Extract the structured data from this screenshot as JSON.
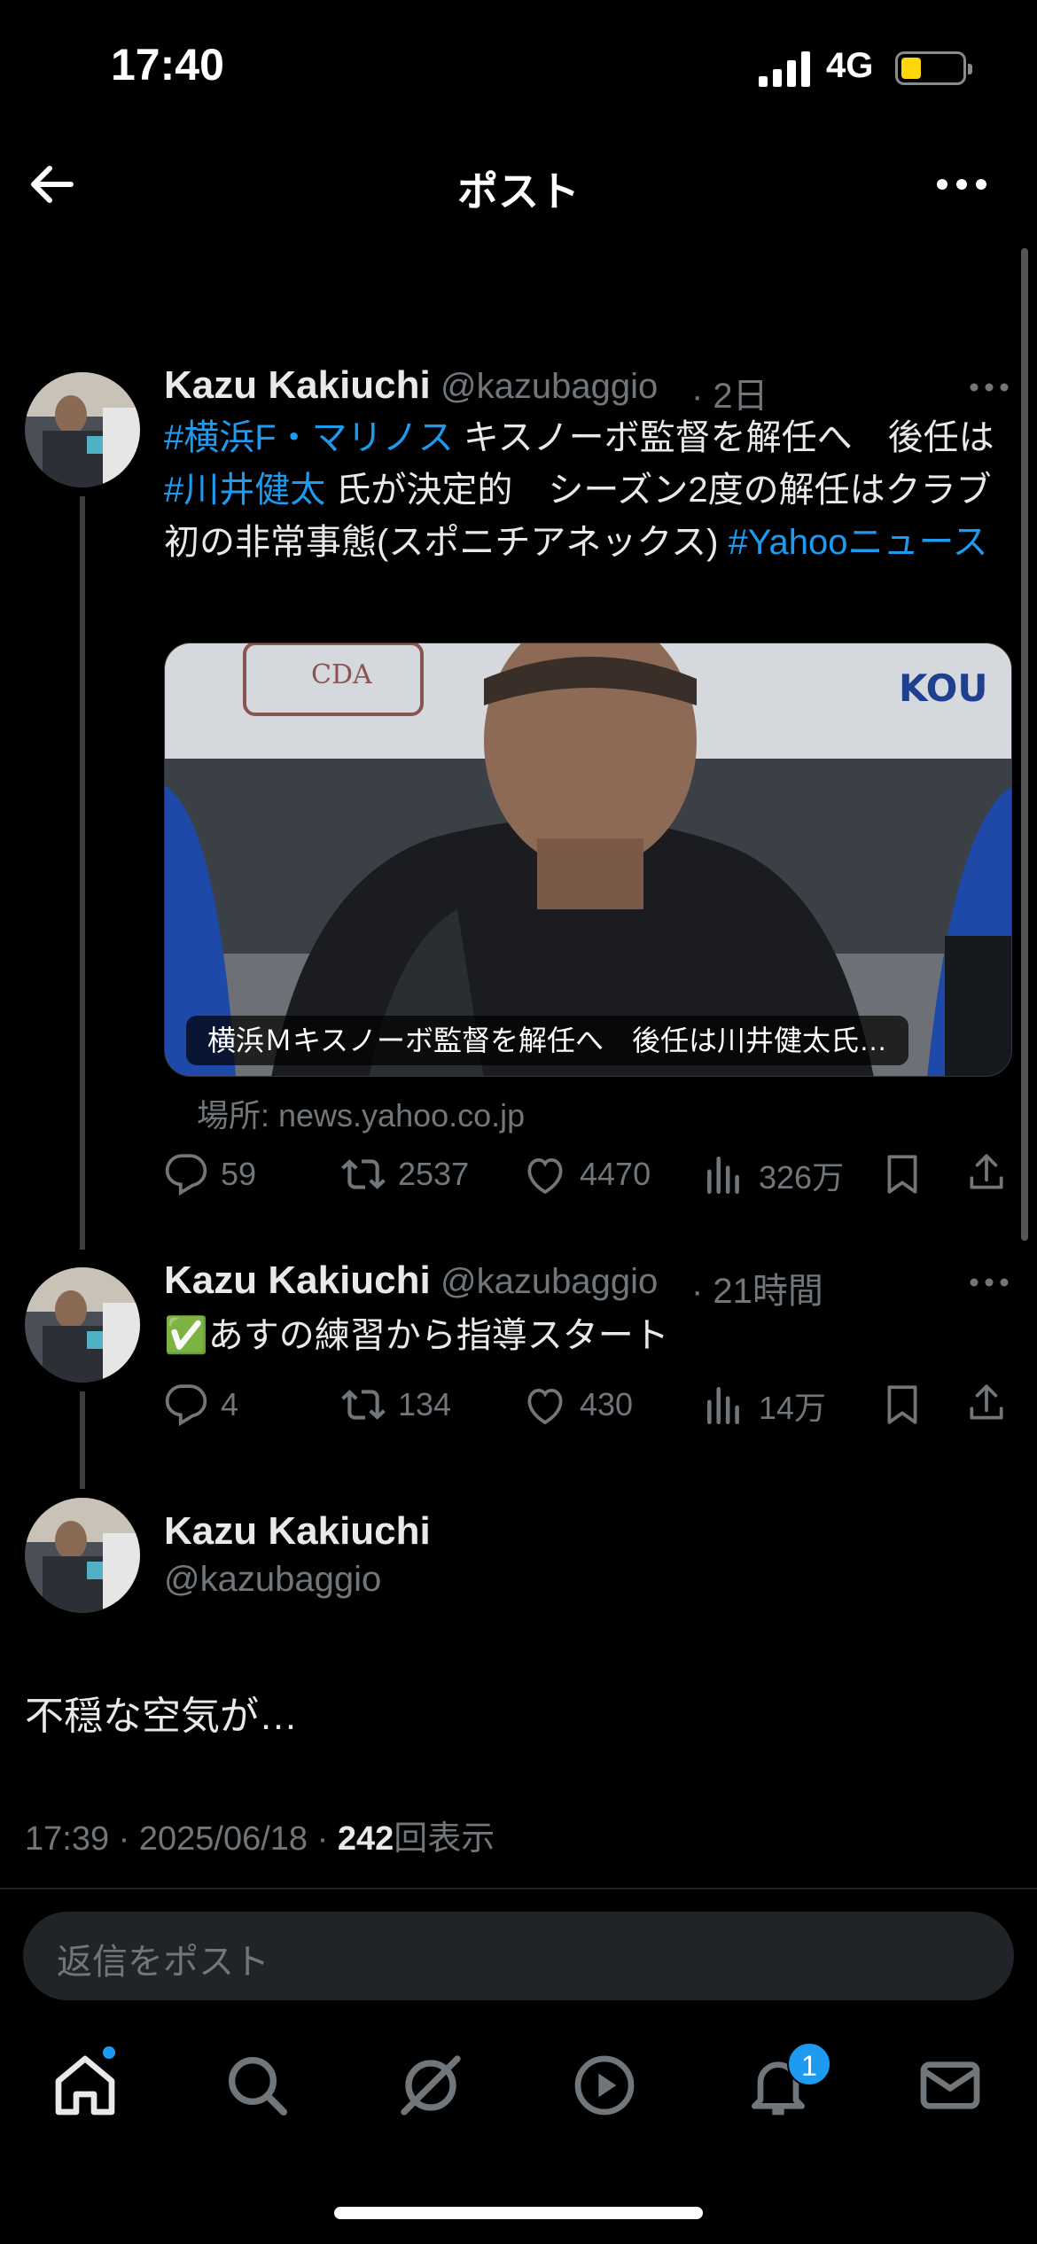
{
  "status_bar": {
    "time": "17:40",
    "network": "4G"
  },
  "header": {
    "title": "ポスト"
  },
  "tweets": [
    {
      "name": "Kazu Kakiuchi",
      "handle": "@kazubaggio",
      "time": "· 2日",
      "text_parts": {
        "tag1": "#横浜F・マリノス",
        "t1": " キスノーボ監督を解任へ　後任は ",
        "tag2": "#川井健太",
        "t2": " 氏が決定的　シーズン2度の解任はクラブ初の非常事態(スポニチアネックス) ",
        "tag3": "#Yahooニュース"
      },
      "card_caption": "横浜Ｍキスノーボ監督を解任へ　後任は川井健太氏…",
      "card_source": "場所: news.yahoo.co.jp",
      "actions": {
        "replies": "59",
        "retweets": "2537",
        "likes": "4470",
        "views": "326万"
      }
    },
    {
      "name": "Kazu Kakiuchi",
      "handle": "@kazubaggio",
      "time": "· 21時間",
      "text": "✅あすの練習から指導スタート",
      "actions": {
        "replies": "4",
        "retweets": "134",
        "likes": "430",
        "views": "14万"
      }
    }
  ],
  "main_tweet": {
    "name": "Kazu Kakiuchi",
    "handle": "@kazubaggio",
    "text": "不穏な空気が…",
    "timestamp": "17:39 · 2025/06/18 · ",
    "views_count": "242",
    "views_label": "回表示"
  },
  "reply": {
    "placeholder": "返信をポスト"
  },
  "bottom_nav": {
    "notifications_badge": "1"
  },
  "colors": {
    "accent": "#1d9bf0",
    "muted": "#71767b",
    "background": "#000000",
    "battery": "#ffd60a"
  },
  "icons": [
    "back-arrow-icon",
    "more-icon",
    "reply-icon",
    "retweet-icon",
    "like-icon",
    "views-icon",
    "bookmark-icon",
    "share-icon",
    "home-icon",
    "search-icon",
    "grok-icon",
    "video-icon",
    "bell-icon",
    "mail-icon"
  ]
}
